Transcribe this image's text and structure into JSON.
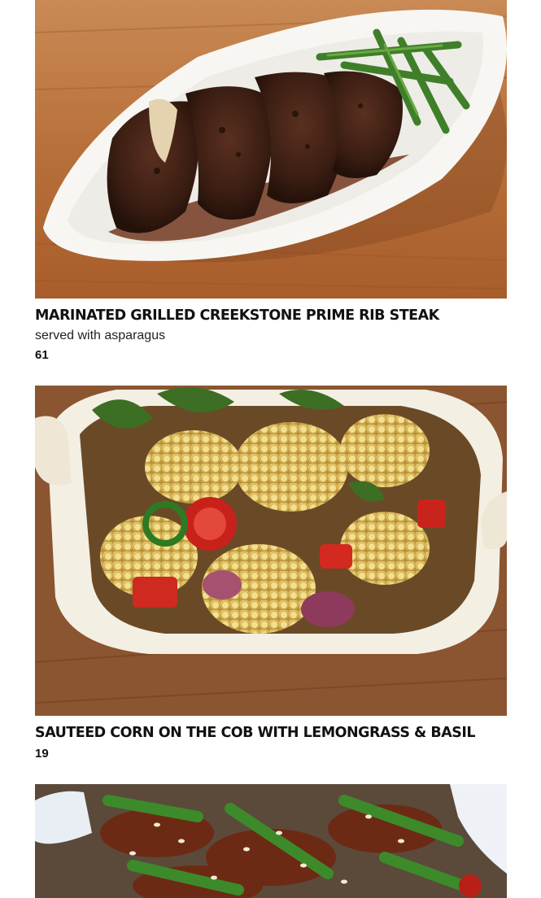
{
  "menu": {
    "items": [
      {
        "name": "MARINATED GRILLED CREEKSTONE PRIME RIB STEAK",
        "description": "served with asparagus",
        "price": "61",
        "photo_icon": "steak-photo"
      },
      {
        "name": "SAUTEED CORN ON THE COB WITH LEMONGRASS & BASIL",
        "description": "",
        "price": "19",
        "photo_icon": "corn-photo"
      },
      {
        "name": "",
        "description": "",
        "price": "",
        "photo_icon": "stir-fry-photo"
      }
    ]
  },
  "colors": {
    "wood": "#b86a36",
    "plate": "#f7f6f2",
    "text": "#111111"
  }
}
